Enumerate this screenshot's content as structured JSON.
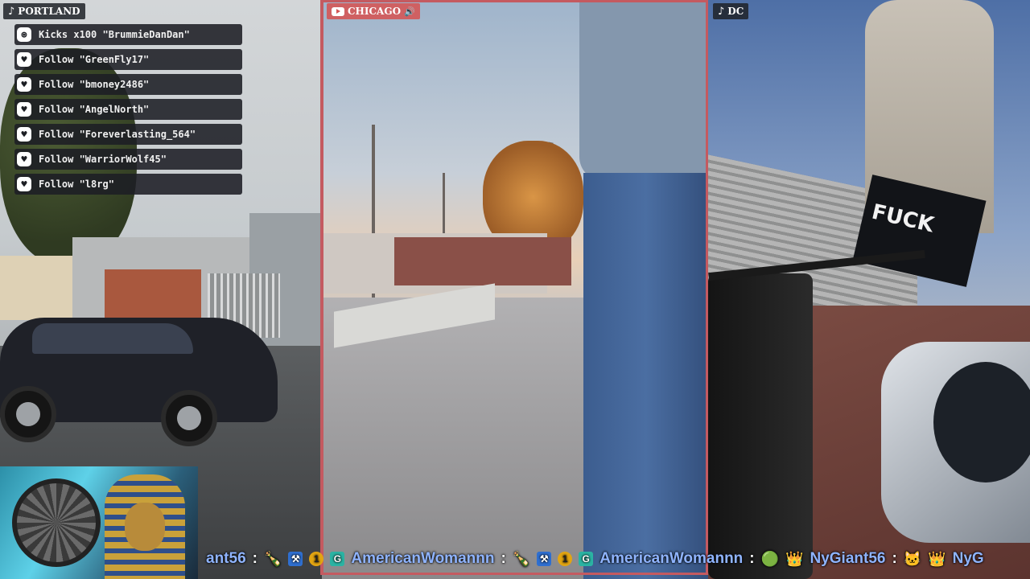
{
  "streams": {
    "left": {
      "label": "PORTLAND",
      "platform_icon": "tiktok-icon"
    },
    "center": {
      "label": "CHICAGO",
      "platform_icon": "youtube-icon",
      "audio_icon": "speaker-icon"
    },
    "right": {
      "label": "DC",
      "platform_icon": "tiktok-icon"
    }
  },
  "events": [
    {
      "icon": "kick-icon",
      "glyph": "⊛",
      "text": "Kicks x100 \"BrummieDanDan\""
    },
    {
      "icon": "heart-icon",
      "glyph": "♥",
      "text": "Follow \"GreenFly17\""
    },
    {
      "icon": "heart-icon",
      "glyph": "♥",
      "text": "Follow \"bmoney2486\""
    },
    {
      "icon": "heart-icon",
      "glyph": "♥",
      "text": "Follow \"AngelNorth\""
    },
    {
      "icon": "heart-icon",
      "glyph": "♥",
      "text": "Follow \"Foreverlasting_564\""
    },
    {
      "icon": "heart-icon",
      "glyph": "♥",
      "text": "Follow \"WarriorWolf45\""
    },
    {
      "icon": "heart-icon",
      "glyph": "♥",
      "text": "Follow \"l8rg\""
    }
  ],
  "scene_text": {
    "flag": "FUCK"
  },
  "chat_ticker": {
    "separator": ":",
    "messages": [
      {
        "user": "ant56",
        "emote": "🍾"
      },
      {
        "user": "AmericanWomannn",
        "badges": [
          "⚒",
          "1",
          "G"
        ],
        "emote": "🍾"
      },
      {
        "user": "AmericanWomannn",
        "badges": [
          "⚒",
          "1",
          "G"
        ],
        "emote": "🟢"
      },
      {
        "user": "NyGiant56",
        "emote": "🐱",
        "lead_emote": "👑"
      },
      {
        "user": "NyG",
        "lead_emote": "👑"
      }
    ]
  },
  "colors": {
    "frame_accent": "#c45a60",
    "username": "#8fb4ff"
  }
}
